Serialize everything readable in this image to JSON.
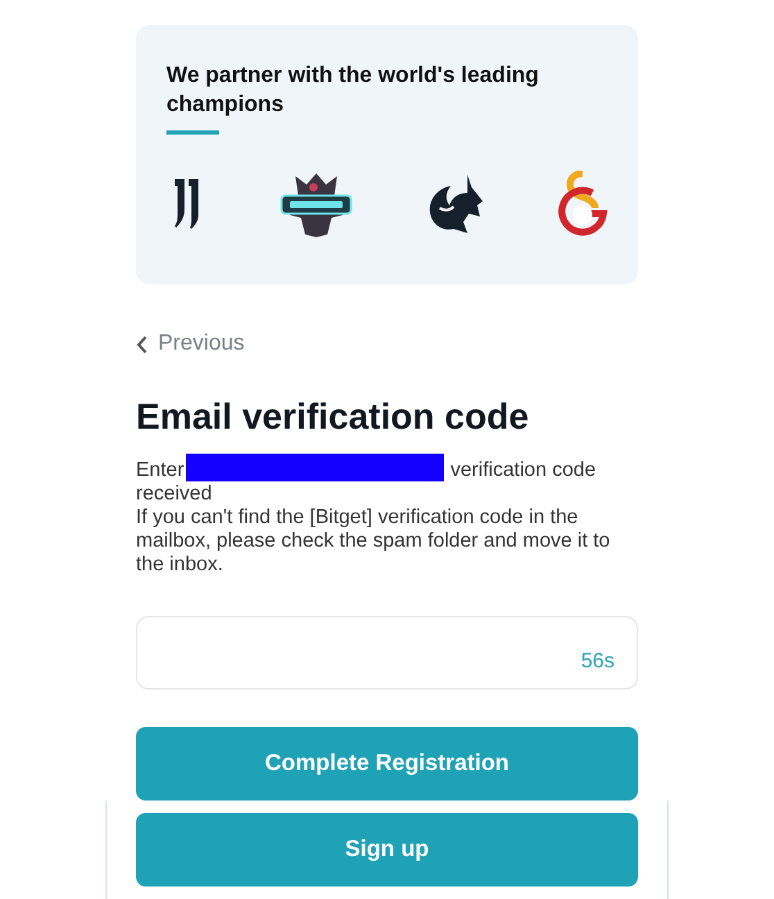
{
  "partner_card": {
    "heading": "We partner with the world's leading champions",
    "logos": [
      {
        "kind": "j-mark"
      },
      {
        "kind": "badge"
      },
      {
        "kind": "dragon"
      },
      {
        "kind": "ring"
      }
    ]
  },
  "back_link": "Previous",
  "title": "Email verification code",
  "intro": {
    "before": "Enter",
    "after": "verification code received",
    "redacted": true
  },
  "hint": "If you can't find the [Bitget] verification code in the mailbox, please check the spam folder and move it to the inbox.",
  "code_field": {
    "countdown": "56s"
  },
  "buttons": [
    {
      "label": "Complete Registration"
    },
    {
      "label": "Sign up"
    }
  ]
}
